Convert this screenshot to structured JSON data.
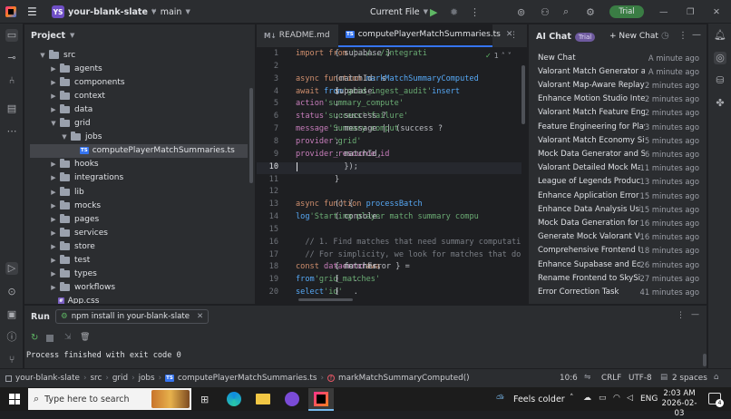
{
  "titlebar": {
    "project_badge": "YS",
    "project_name": "your-blank-slate",
    "branch": "main",
    "run_config": "Current File",
    "trial_label": "Trial"
  },
  "project_panel": {
    "title": "Project",
    "tree": [
      {
        "label": "src",
        "depth": 0,
        "expanded": true,
        "type": "folder"
      },
      {
        "label": "agents",
        "depth": 1,
        "expanded": false,
        "type": "folder"
      },
      {
        "label": "components",
        "depth": 1,
        "expanded": false,
        "type": "folder"
      },
      {
        "label": "context",
        "depth": 1,
        "expanded": false,
        "type": "folder"
      },
      {
        "label": "data",
        "depth": 1,
        "expanded": false,
        "type": "folder"
      },
      {
        "label": "grid",
        "depth": 1,
        "expanded": true,
        "type": "folder"
      },
      {
        "label": "jobs",
        "depth": 2,
        "expanded": true,
        "type": "folder"
      },
      {
        "label": "computePlayerMatchSummaries.ts",
        "depth": 3,
        "type": "ts-file",
        "selected": true
      },
      {
        "label": "hooks",
        "depth": 1,
        "expanded": false,
        "type": "folder"
      },
      {
        "label": "integrations",
        "depth": 1,
        "expanded": false,
        "type": "folder"
      },
      {
        "label": "lib",
        "depth": 1,
        "expanded": false,
        "type": "folder"
      },
      {
        "label": "mocks",
        "depth": 1,
        "expanded": false,
        "type": "folder"
      },
      {
        "label": "pages",
        "depth": 1,
        "expanded": false,
        "type": "folder"
      },
      {
        "label": "services",
        "depth": 1,
        "expanded": false,
        "type": "folder"
      },
      {
        "label": "store",
        "depth": 1,
        "expanded": false,
        "type": "folder"
      },
      {
        "label": "test",
        "depth": 1,
        "expanded": false,
        "type": "folder"
      },
      {
        "label": "types",
        "depth": 1,
        "expanded": false,
        "type": "folder"
      },
      {
        "label": "workflows",
        "depth": 1,
        "expanded": false,
        "type": "folder"
      },
      {
        "label": "App.css",
        "depth": 1,
        "type": "css-file"
      }
    ]
  },
  "editor": {
    "tabs": [
      {
        "label": "README.md",
        "icon": "M↓",
        "active": false
      },
      {
        "label": "computePlayerMatchSummaries.ts",
        "icon": "TS",
        "active": true
      }
    ],
    "inspection_count": "1",
    "current_line": 10,
    "lines": [
      {
        "n": "1",
        "segs": [
          [
            "kw",
            "import "
          ],
          [
            "tx",
            "{ supabase } "
          ],
          [
            "kw",
            "from "
          ],
          [
            "str",
            "'../../integrati"
          ]
        ]
      },
      {
        "n": "2",
        "segs": []
      },
      {
        "n": "3",
        "segs": [
          [
            "kw",
            "async function "
          ],
          [
            "fn",
            "markMatchSummaryComputed"
          ],
          [
            "tx",
            "(matchId: s"
          ]
        ]
      },
      {
        "n": "4",
        "segs": [
          [
            "tx",
            "  "
          ],
          [
            "kw",
            "await "
          ],
          [
            "tx",
            "supabase."
          ],
          [
            "fn",
            "from"
          ],
          [
            "tx",
            "("
          ],
          [
            "str",
            "'grid_ingest_audit'"
          ],
          [
            "tx",
            ")."
          ],
          [
            "fn",
            "insert"
          ],
          [
            "tx",
            "("
          ]
        ]
      },
      {
        "n": "5",
        "segs": [
          [
            "tx",
            "    "
          ],
          [
            "prop",
            "action"
          ],
          [
            "tx",
            ": "
          ],
          [
            "str",
            "'summary_compute'"
          ],
          [
            "tx",
            ","
          ]
        ]
      },
      {
        "n": "6",
        "segs": [
          [
            "tx",
            "    "
          ],
          [
            "prop",
            "status"
          ],
          [
            "tx",
            ": success ? "
          ],
          [
            "str",
            "'success'"
          ],
          [
            "tx",
            " : "
          ],
          [
            "str",
            "'failure'"
          ],
          [
            "tx",
            ","
          ]
        ]
      },
      {
        "n": "7",
        "segs": [
          [
            "tx",
            "    "
          ],
          [
            "prop",
            "message"
          ],
          [
            "tx",
            ": message || (success ? "
          ],
          [
            "str",
            "'Summary comput"
          ]
        ]
      },
      {
        "n": "8",
        "segs": [
          [
            "tx",
            "    "
          ],
          [
            "prop",
            "provider"
          ],
          [
            "tx",
            ": "
          ],
          [
            "str",
            "'grid'"
          ],
          [
            "tx",
            ","
          ]
        ]
      },
      {
        "n": "9",
        "segs": [
          [
            "tx",
            "    "
          ],
          [
            "prop",
            "provider_resource_id"
          ],
          [
            "tx",
            ": matchId,"
          ]
        ]
      },
      {
        "n": "10",
        "segs": [
          [
            "tx",
            "  });"
          ]
        ]
      },
      {
        "n": "11",
        "segs": [
          [
            "tx",
            "}"
          ]
        ]
      },
      {
        "n": "12",
        "segs": []
      },
      {
        "n": "13",
        "segs": [
          [
            "kw",
            "async function "
          ],
          [
            "fn",
            "processBatch"
          ],
          [
            "tx",
            "() {"
          ]
        ]
      },
      {
        "n": "14",
        "segs": [
          [
            "tx",
            "  console."
          ],
          [
            "fn",
            "log"
          ],
          [
            "tx",
            "("
          ],
          [
            "str",
            "'Starting player match summary compu"
          ]
        ]
      },
      {
        "n": "15",
        "segs": []
      },
      {
        "n": "16",
        "segs": [
          [
            "cm",
            "  // 1. Find matches that need summary computation"
          ]
        ]
      },
      {
        "n": "17",
        "segs": [
          [
            "cm",
            "  // For simplicity, we look for matches that don'"
          ]
        ]
      },
      {
        "n": "18",
        "segs": [
          [
            "tx",
            "  "
          ],
          [
            "kw",
            "const "
          ],
          [
            "tx",
            "{ "
          ],
          [
            "prop",
            "data"
          ],
          [
            "tx",
            ": matches, "
          ],
          [
            "prop",
            "error"
          ],
          [
            "tx",
            ": fetchError } = "
          ],
          [
            "kw",
            "awa"
          ]
        ]
      },
      {
        "n": "19",
        "segs": [
          [
            "tx",
            "    ."
          ],
          [
            "fn",
            "from"
          ],
          [
            "tx",
            "("
          ],
          [
            "str",
            "'grid_matches'"
          ],
          [
            "tx",
            ")"
          ]
        ]
      },
      {
        "n": "20",
        "segs": [
          [
            "tx",
            "    ."
          ],
          [
            "fn",
            "select"
          ],
          [
            "tx",
            "("
          ],
          [
            "str",
            "'id'"
          ],
          [
            "tx",
            ")"
          ]
        ]
      }
    ]
  },
  "ai_chat": {
    "title": "AI Chat",
    "badge": "Trial",
    "new_chat_label": "+ New Chat",
    "items": [
      {
        "title": "New Chat",
        "when": "A minute ago"
      },
      {
        "title": "Valorant Match Generator and R",
        "when": "A minute ago"
      },
      {
        "title": "Valorant Map-Aware Replay Fra",
        "when": "2 minutes ago"
      },
      {
        "title": "Enhance Motion Studio Integrat",
        "when": "2 minutes ago"
      },
      {
        "title": "Valorant Match Feature Enginee",
        "when": "2 minutes ago"
      },
      {
        "title": "Feature Engineering for Player-",
        "when": "3 minutes ago"
      },
      {
        "title": "Valorant Match Economy Simul",
        "when": "5 minutes ago"
      },
      {
        "title": "Mock Data Generator and Strea",
        "when": "6 minutes ago"
      },
      {
        "title": "Valorant Detailed Mock Match",
        "when": "11 minutes ago"
      },
      {
        "title": "League of Legends Production",
        "when": "13 minutes ago"
      },
      {
        "title": "Enhance Application Error Har",
        "when": "15 minutes ago"
      },
      {
        "title": "Enhance Data Analysis Using (",
        "when": "15 minutes ago"
      },
      {
        "title": "Mock Data Generation for LoL",
        "when": "16 minutes ago"
      },
      {
        "title": "Generate Mock Valorant VOD",
        "when": "16 minutes ago"
      },
      {
        "title": "Comprehensive Frontend Upg",
        "when": "18 minutes ago"
      },
      {
        "title": "Enhance Supabase and Edge F",
        "when": "26 minutes ago"
      },
      {
        "title": "Rename Frontend to SkySim T",
        "when": "27 minutes ago"
      },
      {
        "title": "Error Correction Task",
        "when": "41 minutes ago"
      }
    ]
  },
  "run_panel": {
    "title": "Run",
    "tab_label": "npm install in your-blank-slate",
    "output": "Process finished with exit code 0"
  },
  "statusbar": {
    "breadcrumb": [
      "your-blank-slate",
      "src",
      "grid",
      "jobs",
      "computePlayerMatchSummaries.ts",
      "markMatchSummaryComputed()"
    ],
    "position": "10:6",
    "line_ending": "CRLF",
    "encoding": "UTF-8",
    "indent": "2 spaces"
  },
  "taskbar": {
    "search_placeholder": "Type here to search",
    "weather": "Feels colder",
    "language": "ENG",
    "time": "2:03 AM",
    "date": "2026-02-03",
    "notification_count": "4"
  },
  "colors": {
    "accent": "#3574f0",
    "trial_green": "#3a7d44",
    "project_badge": "#6f4fc6"
  }
}
